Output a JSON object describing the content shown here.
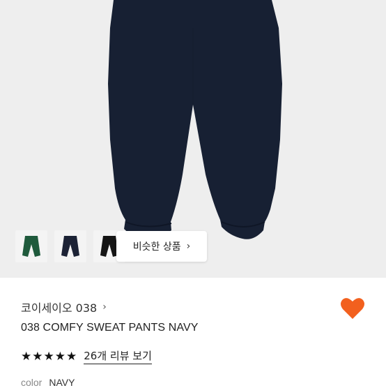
{
  "product_image": {
    "alt_icon": "navy-sweatpants-image"
  },
  "thumbnails": [
    {
      "name": "green-pants-thumb",
      "color": "#1f5a3c"
    },
    {
      "name": "navy-pants-thumb",
      "color": "#1c2235"
    },
    {
      "name": "black-pants-thumb",
      "color": "#151515"
    }
  ],
  "similar_button": {
    "label": "비슷한 상품",
    "chevron": "›"
  },
  "brand": {
    "name": "코이세이오 038",
    "chevron": "›"
  },
  "product": {
    "title": "038 COMFY SWEAT PANTS NAVY",
    "rating_stars": 5,
    "review_link": "26개 리뷰 보기",
    "color_label": "color",
    "color_value": "NAVY"
  },
  "colors": {
    "heart": "#f2601e",
    "pants": "#172033",
    "background": "#eeeeee"
  }
}
